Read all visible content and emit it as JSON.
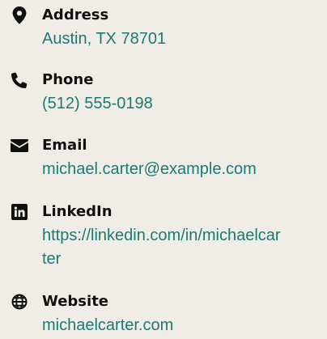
{
  "colors": {
    "background": "#f0ede6",
    "label": "#111111",
    "value": "#1b7a77",
    "icon": "#111111"
  },
  "contacts": [
    {
      "icon": "map-marker-icon",
      "label": "Address",
      "value": "Austin, TX 78701"
    },
    {
      "icon": "phone-icon",
      "label": "Phone",
      "value": "(512) 555-0198"
    },
    {
      "icon": "envelope-icon",
      "label": "Email",
      "value": "michael.carter@example.com"
    },
    {
      "icon": "linkedin-icon",
      "label": "LinkedIn",
      "value": "https://linkedin.com/in/michaelcarter"
    },
    {
      "icon": "globe-icon",
      "label": "Website",
      "value": "michaelcarter.com"
    }
  ]
}
